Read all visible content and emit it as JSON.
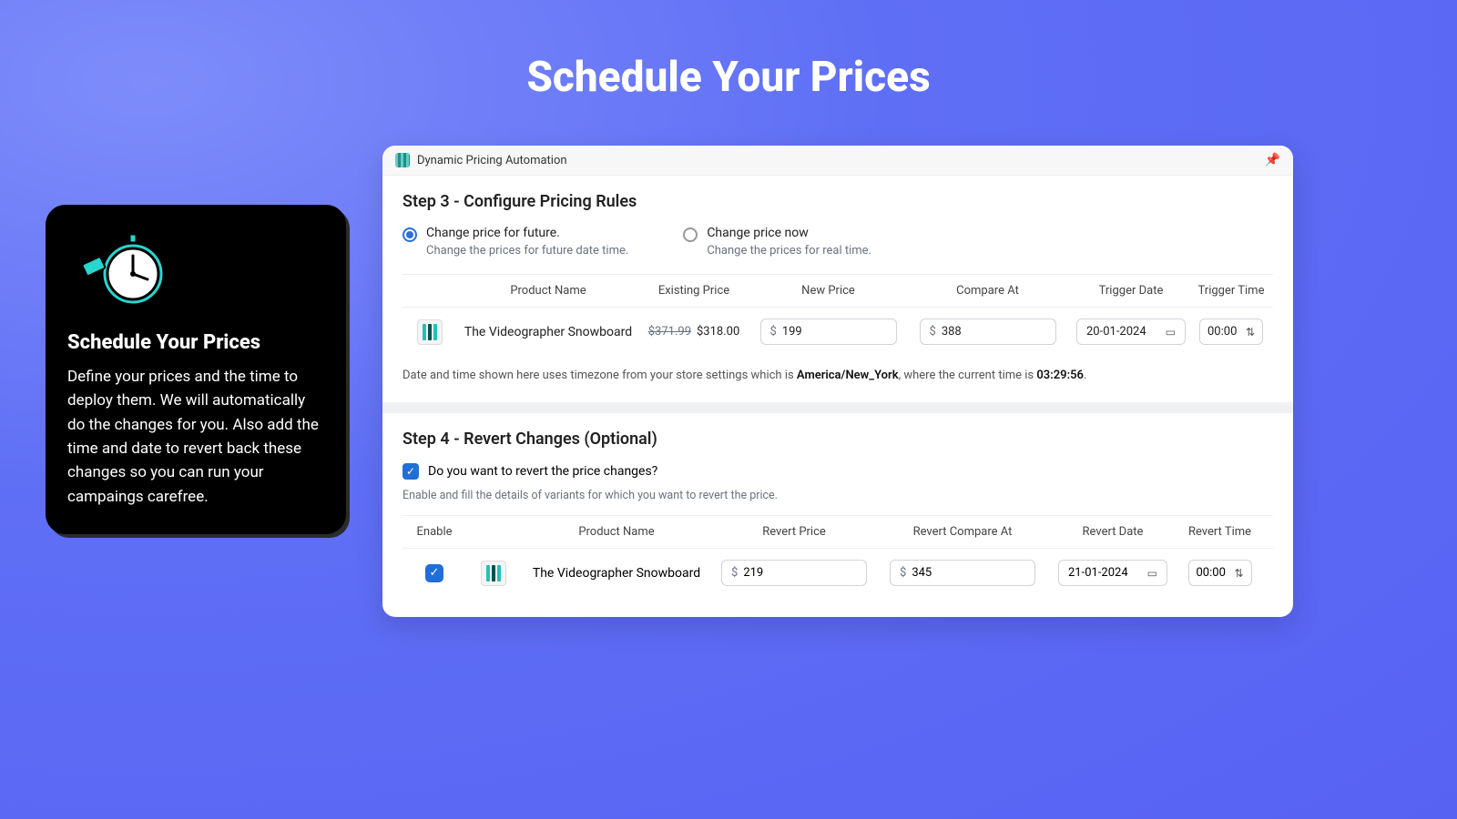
{
  "page_title": "Schedule Your Prices",
  "info": {
    "heading": "Schedule Your Prices",
    "body": "Define your prices and the time to deploy them. We will automatically do the changes for you. Also add the time and date to revert back these changes so you can run your campaings carefree."
  },
  "app": {
    "title": "Dynamic Pricing Automation",
    "step3": {
      "title": "Step 3 - Configure Pricing Rules",
      "option_future": {
        "label": "Change price for future.",
        "sub": "Change the prices for future date time."
      },
      "option_now": {
        "label": "Change price now",
        "sub": "Change the prices for real time."
      },
      "headers": {
        "product": "Product Name",
        "existing": "Existing Price",
        "new": "New Price",
        "compare": "Compare At",
        "date": "Trigger Date",
        "time": "Trigger Time"
      },
      "row": {
        "product": "The Videographer Snowboard",
        "old_price": "$371.99",
        "cur_price": "$318.00",
        "new_price": "199",
        "compare_at": "388",
        "date": "20-01-2024",
        "time": "00:00"
      },
      "note_pre": "Date and time shown here uses timezone from your store settings which is ",
      "tz": "America/New_York",
      "note_mid": ", where the current time is ",
      "now": "03:29:56",
      "note_post": "."
    },
    "step4": {
      "title": "Step 4 - Revert Changes (Optional)",
      "chk_label": "Do you want to revert the price changes?",
      "sub": "Enable and fill the details of variants for which you want to revert the price.",
      "headers": {
        "enable": "Enable",
        "product": "Product Name",
        "price": "Revert Price",
        "compare": "Revert Compare At",
        "date": "Revert Date",
        "time": "Revert Time"
      },
      "row": {
        "product": "The Videographer Snowboard",
        "price": "219",
        "compare": "345",
        "date": "21-01-2024",
        "time": "00:00"
      }
    }
  }
}
